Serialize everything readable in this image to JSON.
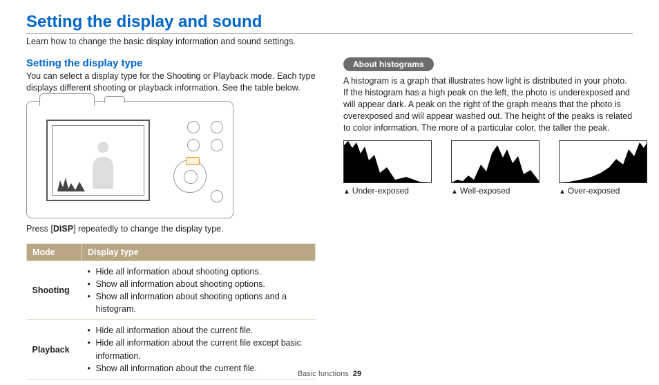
{
  "page": {
    "title": "Setting the display and sound",
    "intro": "Learn how to change the basic display information and sound settings."
  },
  "left": {
    "subhead": "Setting the display type",
    "para": "You can select a display type for the Shooting or Playback mode. Each type displays different shooting or playback information. See the table below.",
    "press_before": "Press [",
    "press_key": "DISP",
    "press_after": "] repeatedly to change the display type.",
    "table": {
      "headers": {
        "mode": "Mode",
        "type": "Display type"
      },
      "rows": [
        {
          "mode": "Shooting",
          "items": [
            "Hide all information about shooting options.",
            "Show all information about shooting options.",
            "Show all information about shooting options and a histogram."
          ]
        },
        {
          "mode": "Playback",
          "items": [
            "Hide all information about the current file.",
            "Hide all information about the current file except basic information.",
            "Show all information about the current file."
          ]
        }
      ]
    }
  },
  "right": {
    "pill": "About histograms",
    "para": "A histogram is a graph that illustrates how light is distributed in your photo. If the histogram has a high peak on the left, the photo is underexposed and will appear dark. A peak on the right of the graph means that the photo is overexposed and will appear washed out. The height of the peaks is related to color information. The more of a particular color, the taller the peak.",
    "histos": [
      {
        "caption": "Under-exposed"
      },
      {
        "caption": "Well-exposed"
      },
      {
        "caption": "Over-exposed"
      }
    ]
  },
  "footer": {
    "section": "Basic functions",
    "page_number": "29"
  }
}
